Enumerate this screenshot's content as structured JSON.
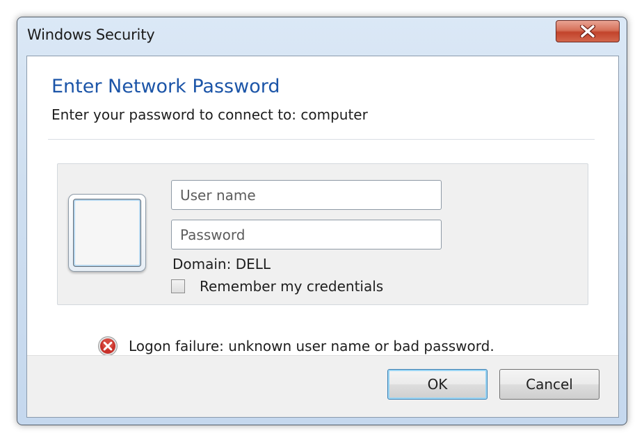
{
  "window": {
    "title": "Windows Security",
    "close_icon": "close-x-icon"
  },
  "dialog": {
    "heading": "Enter Network Password",
    "subheading": "Enter your password to connect to: computer"
  },
  "credentials": {
    "user_icon": "credential-tile-icon",
    "username_placeholder": "User name",
    "username_value": "",
    "password_placeholder": "Password",
    "password_value": "",
    "domain_text": "Domain: DELL",
    "remember_label": "Remember my credentials",
    "remember_checked": false
  },
  "error": {
    "icon": "error-icon",
    "message": "Logon failure: unknown user name or bad password."
  },
  "buttons": {
    "ok_label": "OK",
    "cancel_label": "Cancel"
  },
  "colors": {
    "heading": "#1c55a8",
    "close_button": "#c2432b",
    "error_icon": "#c8312a"
  }
}
